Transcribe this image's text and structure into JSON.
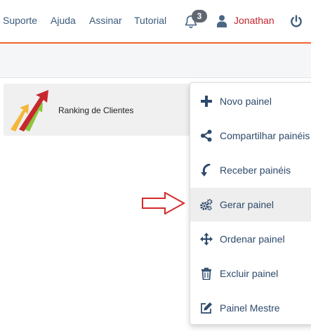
{
  "topbar": {
    "links": [
      "Suporte",
      "Ajuda",
      "Assinar",
      "Tutorial"
    ],
    "notifications_count": "3",
    "user_name": "Jonathan"
  },
  "panels": [
    {
      "title": "Ranking de Clientes"
    }
  ],
  "menu": {
    "items": [
      {
        "label": "Novo painel",
        "icon": "plus-icon"
      },
      {
        "label": "Compartilhar painéis",
        "icon": "share-icon"
      },
      {
        "label": "Receber painéis",
        "icon": "receive-icon"
      },
      {
        "label": "Gerar painel",
        "icon": "gears-icon"
      },
      {
        "label": "Ordenar painel",
        "icon": "move-arrows-icon"
      },
      {
        "label": "Excluir painel",
        "icon": "trash-icon"
      },
      {
        "label": "Painel Mestre",
        "icon": "edit-icon"
      }
    ],
    "highlighted": "Gerar painel"
  },
  "colors": {
    "accent": "#f0652d",
    "nav_text": "#3b5a7c",
    "user_text": "#c0262e",
    "menu_text": "#2d4a6b",
    "pointer_arrow": "#d42a2a"
  }
}
